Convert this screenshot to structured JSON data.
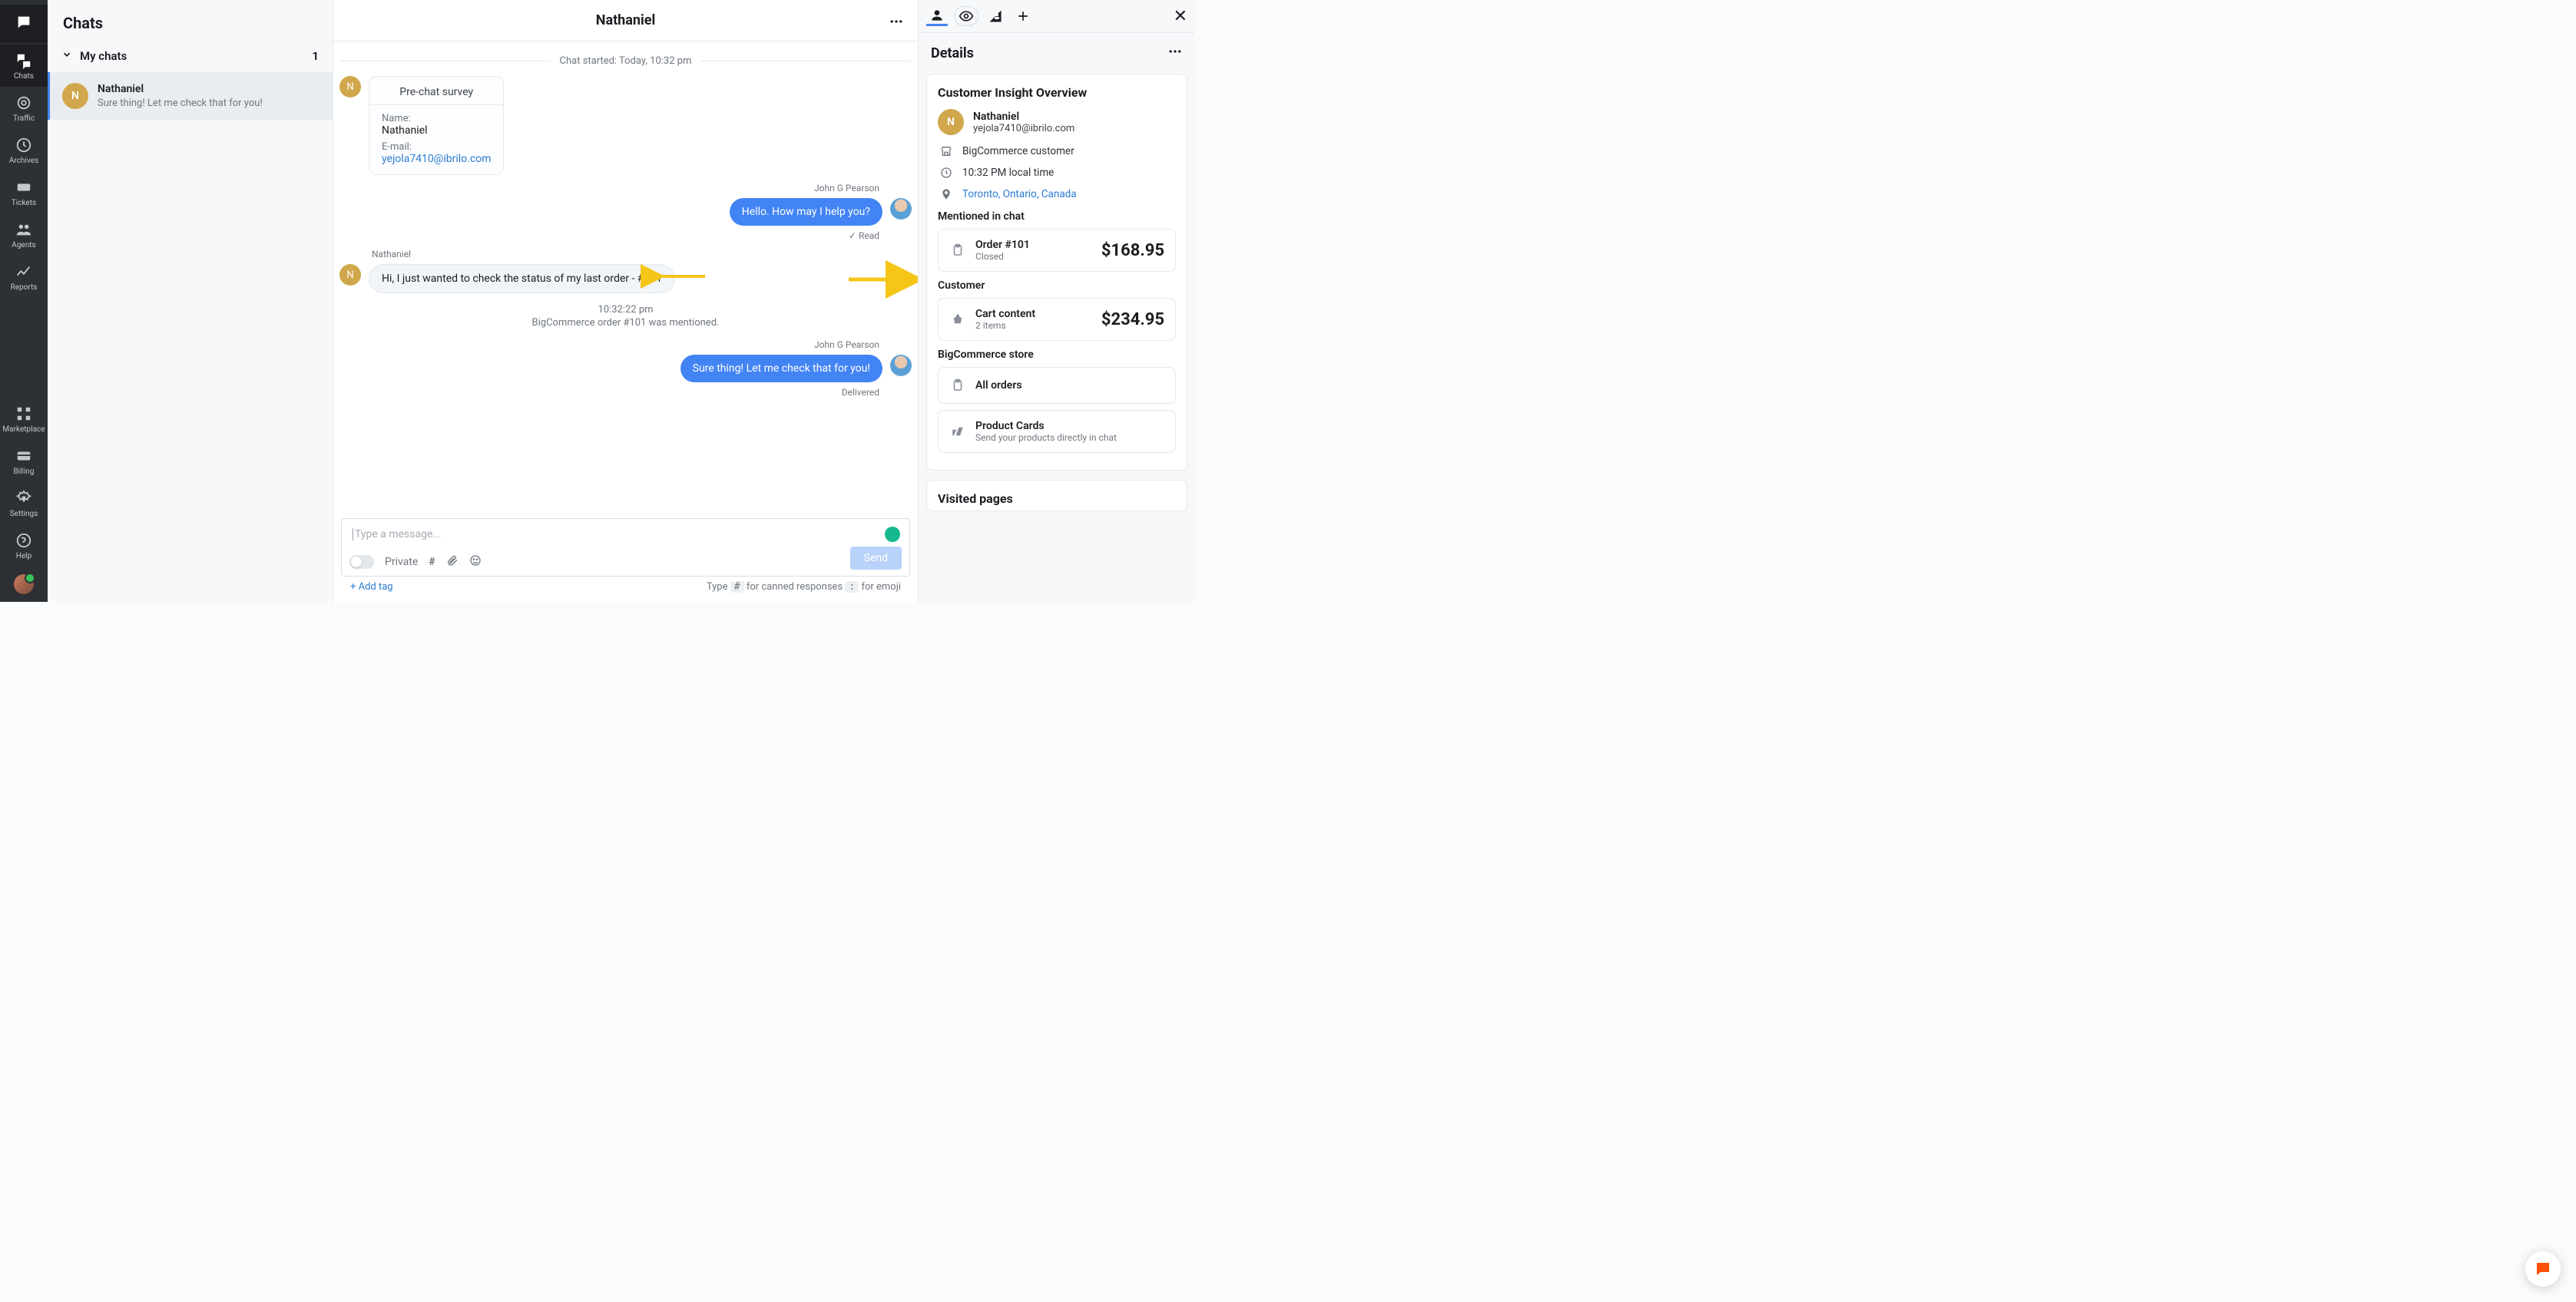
{
  "rail": {
    "items": [
      {
        "name": "logo",
        "label": ""
      },
      {
        "name": "chats",
        "label": "Chats"
      },
      {
        "name": "traffic",
        "label": "Traffic"
      },
      {
        "name": "archives",
        "label": "Archives"
      },
      {
        "name": "tickets",
        "label": "Tickets"
      },
      {
        "name": "agents",
        "label": "Agents"
      },
      {
        "name": "reports",
        "label": "Reports"
      }
    ],
    "bottom": [
      {
        "name": "marketplace",
        "label": "Marketplace"
      },
      {
        "name": "billing",
        "label": "Billing"
      },
      {
        "name": "settings",
        "label": "Settings"
      },
      {
        "name": "help",
        "label": "Help"
      }
    ]
  },
  "list": {
    "title": "Chats",
    "group": "My chats",
    "count": "1",
    "row": {
      "initial": "N",
      "name": "Nathaniel",
      "snippet": "Sure thing! Let me check that for you!"
    }
  },
  "conv": {
    "title": "Nathaniel",
    "startDivider": "Chat started: Today, 10:32 pm",
    "survey": {
      "title": "Pre-chat survey",
      "nameLabel": "Name:",
      "nameVal": "Nathaniel",
      "emailLabel": "E-mail:",
      "emailVal": "yejola7410@ibrilo.com"
    },
    "agentName": "John G Pearson",
    "agentMsg1": "Hello. How may I help you?",
    "readTag": "Read",
    "custName": "Nathaniel",
    "custMsg": "Hi, I just wanted to check the status of my last order - #101",
    "systemTime": "10:32:22 pm",
    "systemText": "BigCommerce order #101 was mentioned.",
    "agentMsg2": "Sure thing! Let me check that for you!",
    "deliveredTag": "Delivered",
    "composer": {
      "placeholder": "Type a message...",
      "private": "Private",
      "send": "Send",
      "addTag": "+ Add tag",
      "hintPrefix": "Type",
      "hintCanned": "for canned responses",
      "hintEmoji": "for emoji",
      "hashKey": "#",
      "colonKey": ":"
    }
  },
  "details": {
    "title": "Details",
    "overview": "Customer Insight Overview",
    "name": "Nathaniel",
    "email": "yejola7410@ibrilo.com",
    "bc": "BigCommerce customer",
    "time": "10:32 PM local time",
    "location": "Toronto, Ontario, Canada",
    "mentioned": "Mentioned in chat",
    "order": {
      "title": "Order #101",
      "status": "Closed",
      "price": "$168.95"
    },
    "customerSection": "Customer",
    "cart": {
      "title": "Cart content",
      "sub": "2 items",
      "price": "$234.95"
    },
    "storeSection": "BigCommerce store",
    "allOrders": "All orders",
    "productCards": {
      "title": "Product Cards",
      "sub": "Send your products directly in chat"
    },
    "visited": "Visited pages"
  }
}
